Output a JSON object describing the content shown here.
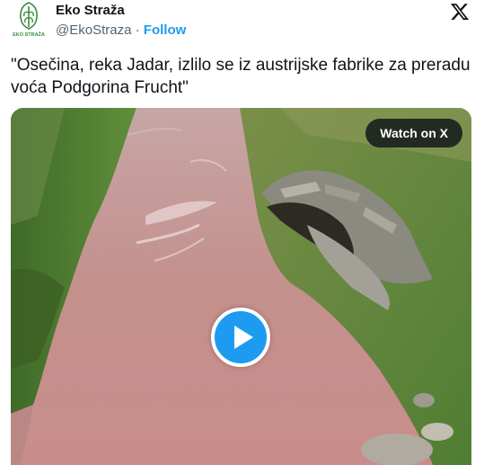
{
  "author": {
    "name": "Eko Straža",
    "handle": "@EkoStraza",
    "separator": "·",
    "follow_label": "Follow",
    "avatar_text": "EKO STRAŽA"
  },
  "tweet": {
    "text": "\"Osečina, reka Jadar, izlilo se iz austrijske fabrike za preradu voća Podgorina Frucht\""
  },
  "media": {
    "watch_label": "Watch on X",
    "play_icon": "play-icon"
  },
  "colors": {
    "accent": "#1d9bf0",
    "river": "#c48f8c",
    "grass": "#4f7e33"
  }
}
